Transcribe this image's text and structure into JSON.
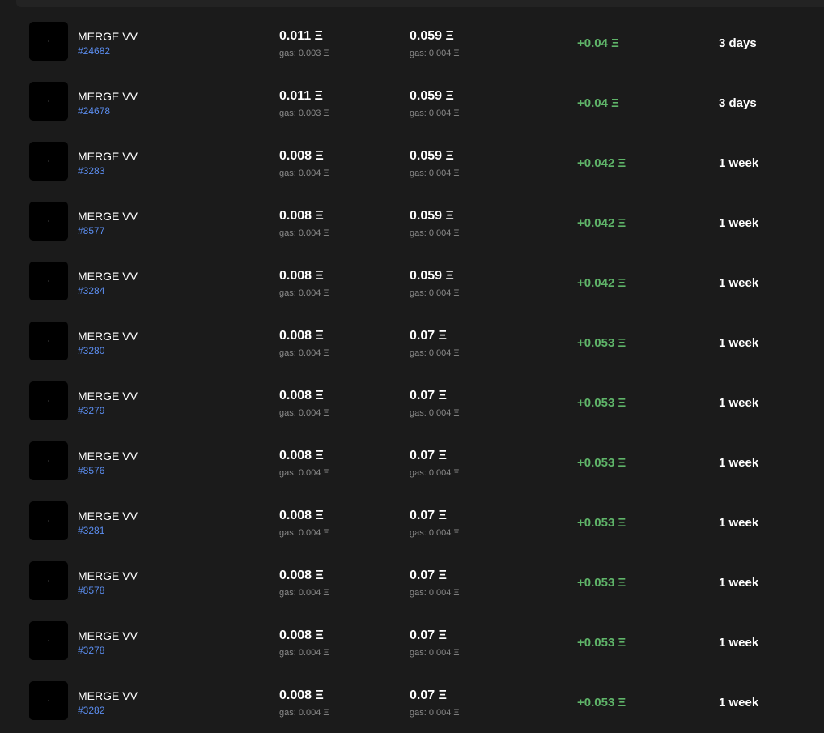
{
  "currency_symbol": "Ξ",
  "colors": {
    "background": "#1b1b1b",
    "profit": "#5fb469",
    "token_id": "#5b8def",
    "muted": "#8a8a8a"
  },
  "rows": [
    {
      "name": "MERGE VV",
      "id": "#24682",
      "buy": "0.011 Ξ",
      "buy_gas": "gas: 0.003 Ξ",
      "sell": "0.059 Ξ",
      "sell_gas": "gas: 0.004 Ξ",
      "profit": "+0.04 Ξ",
      "time": "3 days"
    },
    {
      "name": "MERGE VV",
      "id": "#24678",
      "buy": "0.011 Ξ",
      "buy_gas": "gas: 0.003 Ξ",
      "sell": "0.059 Ξ",
      "sell_gas": "gas: 0.004 Ξ",
      "profit": "+0.04 Ξ",
      "time": "3 days"
    },
    {
      "name": "MERGE VV",
      "id": "#3283",
      "buy": "0.008 Ξ",
      "buy_gas": "gas: 0.004 Ξ",
      "sell": "0.059 Ξ",
      "sell_gas": "gas: 0.004 Ξ",
      "profit": "+0.042 Ξ",
      "time": "1 week"
    },
    {
      "name": "MERGE VV",
      "id": "#8577",
      "buy": "0.008 Ξ",
      "buy_gas": "gas: 0.004 Ξ",
      "sell": "0.059 Ξ",
      "sell_gas": "gas: 0.004 Ξ",
      "profit": "+0.042 Ξ",
      "time": "1 week"
    },
    {
      "name": "MERGE VV",
      "id": "#3284",
      "buy": "0.008 Ξ",
      "buy_gas": "gas: 0.004 Ξ",
      "sell": "0.059 Ξ",
      "sell_gas": "gas: 0.004 Ξ",
      "profit": "+0.042 Ξ",
      "time": "1 week"
    },
    {
      "name": "MERGE VV",
      "id": "#3280",
      "buy": "0.008 Ξ",
      "buy_gas": "gas: 0.004 Ξ",
      "sell": "0.07 Ξ",
      "sell_gas": "gas: 0.004 Ξ",
      "profit": "+0.053 Ξ",
      "time": "1 week"
    },
    {
      "name": "MERGE VV",
      "id": "#3279",
      "buy": "0.008 Ξ",
      "buy_gas": "gas: 0.004 Ξ",
      "sell": "0.07 Ξ",
      "sell_gas": "gas: 0.004 Ξ",
      "profit": "+0.053 Ξ",
      "time": "1 week"
    },
    {
      "name": "MERGE VV",
      "id": "#8576",
      "buy": "0.008 Ξ",
      "buy_gas": "gas: 0.004 Ξ",
      "sell": "0.07 Ξ",
      "sell_gas": "gas: 0.004 Ξ",
      "profit": "+0.053 Ξ",
      "time": "1 week"
    },
    {
      "name": "MERGE VV",
      "id": "#3281",
      "buy": "0.008 Ξ",
      "buy_gas": "gas: 0.004 Ξ",
      "sell": "0.07 Ξ",
      "sell_gas": "gas: 0.004 Ξ",
      "profit": "+0.053 Ξ",
      "time": "1 week"
    },
    {
      "name": "MERGE VV",
      "id": "#8578",
      "buy": "0.008 Ξ",
      "buy_gas": "gas: 0.004 Ξ",
      "sell": "0.07 Ξ",
      "sell_gas": "gas: 0.004 Ξ",
      "profit": "+0.053 Ξ",
      "time": "1 week"
    },
    {
      "name": "MERGE VV",
      "id": "#3278",
      "buy": "0.008 Ξ",
      "buy_gas": "gas: 0.004 Ξ",
      "sell": "0.07 Ξ",
      "sell_gas": "gas: 0.004 Ξ",
      "profit": "+0.053 Ξ",
      "time": "1 week"
    },
    {
      "name": "MERGE VV",
      "id": "#3282",
      "buy": "0.008 Ξ",
      "buy_gas": "gas: 0.004 Ξ",
      "sell": "0.07 Ξ",
      "sell_gas": "gas: 0.004 Ξ",
      "profit": "+0.053 Ξ",
      "time": "1 week"
    }
  ]
}
